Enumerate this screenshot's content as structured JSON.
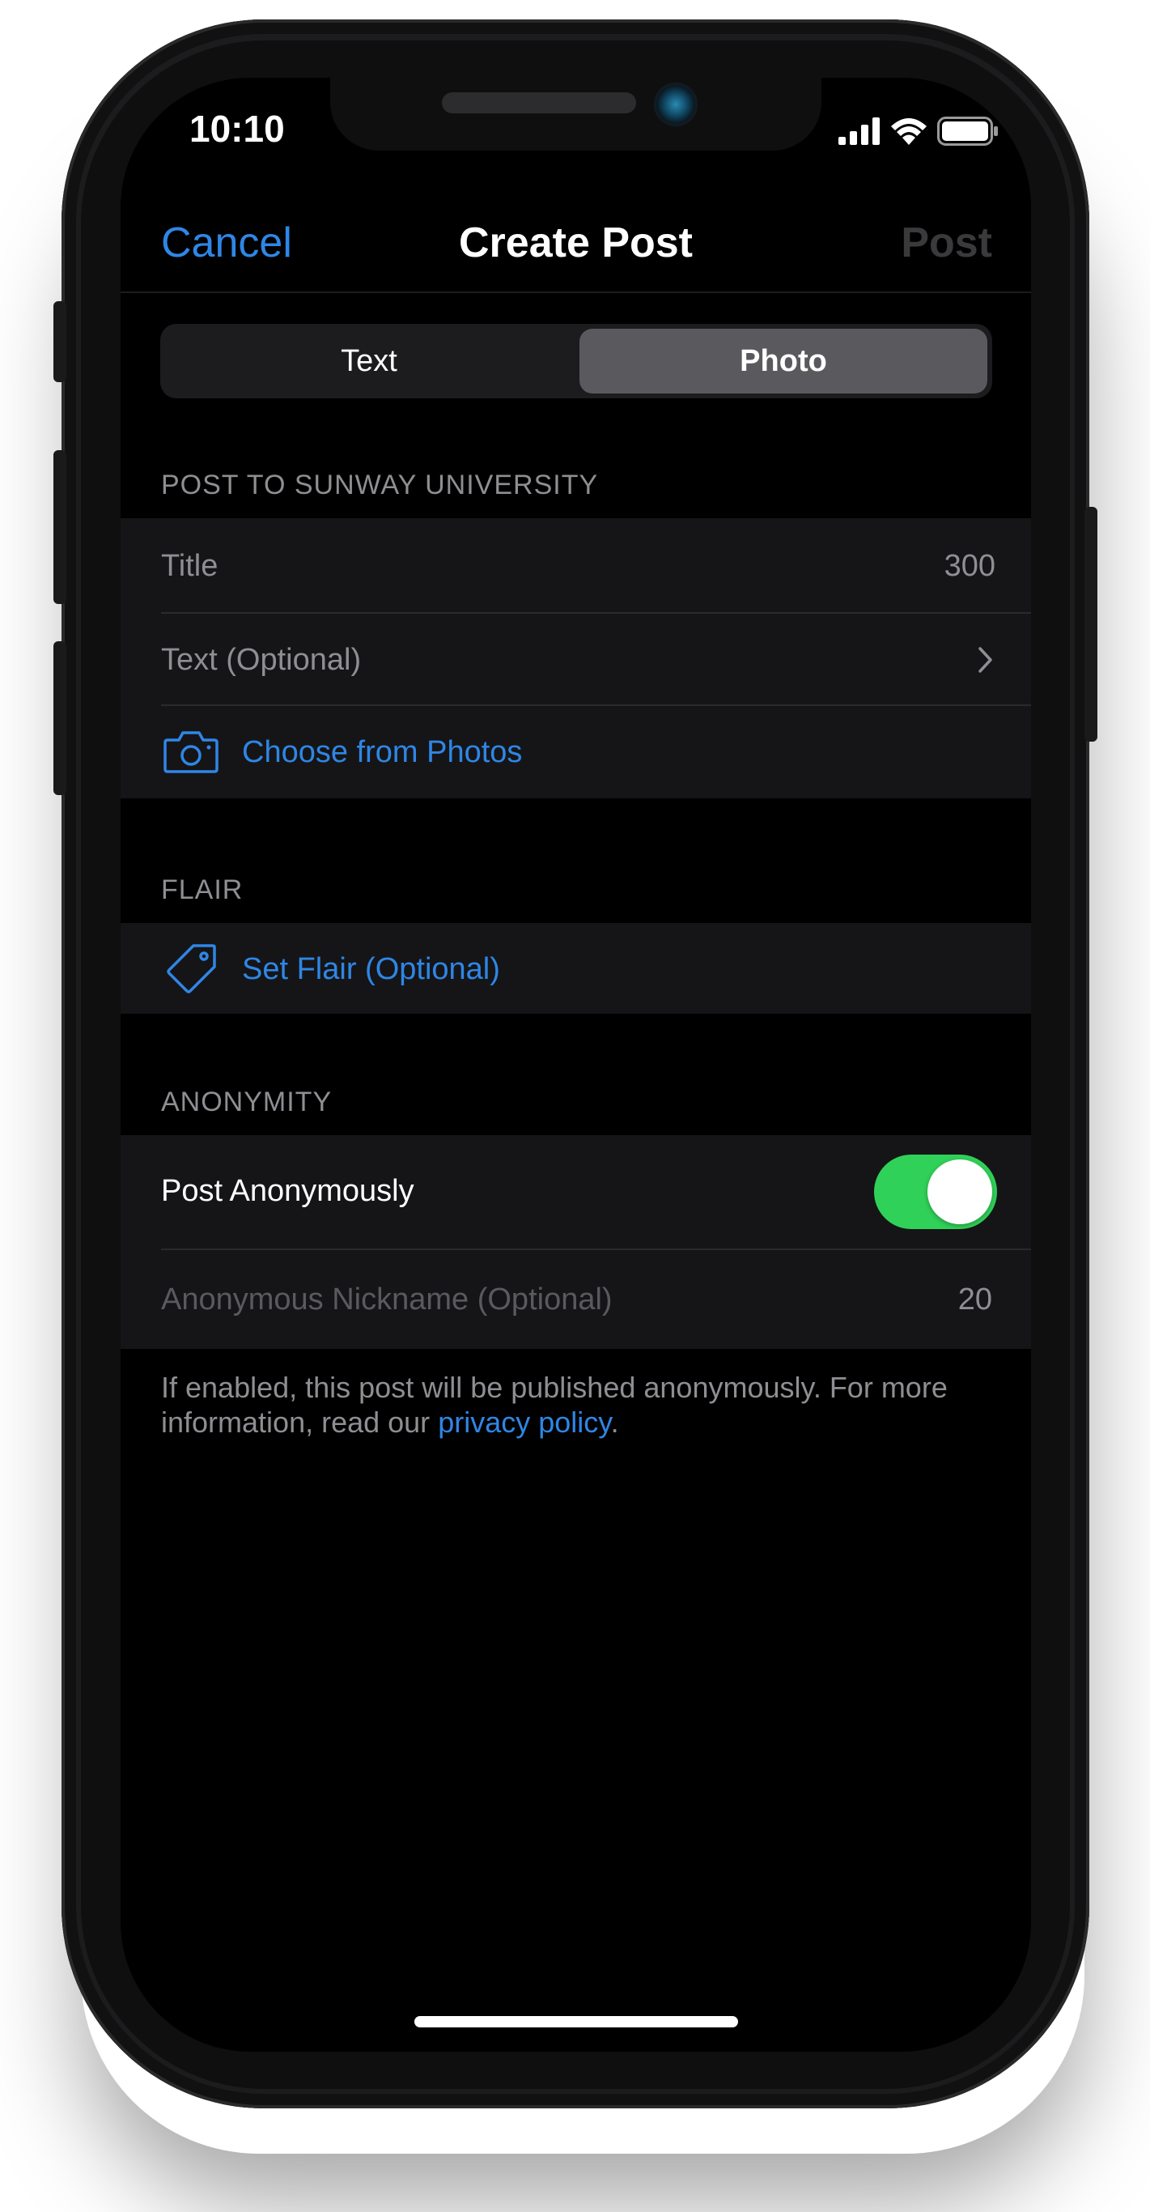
{
  "status_bar": {
    "time": "10:10"
  },
  "nav": {
    "cancel": "Cancel",
    "title": "Create Post",
    "post": "Post"
  },
  "segments": {
    "text": "Text",
    "photo": "Photo",
    "selected": "Photo"
  },
  "post_section": {
    "header": "POST TO SUNWAY UNIVERSITY",
    "title_placeholder": "Title",
    "title_count": "300",
    "text_placeholder": "Text (Optional)",
    "choose_photos": "Choose from Photos"
  },
  "flair_section": {
    "header": "FLAIR",
    "set_flair": "Set Flair (Optional)"
  },
  "anonymity_section": {
    "header": "ANONYMITY",
    "post_anonymously": "Post Anonymously",
    "toggle_on": true,
    "nickname_placeholder": "Anonymous Nickname (Optional)",
    "nickname_count": "20",
    "footnote_prefix": "If enabled, this post will be published anonymously. For more information, read our ",
    "footnote_link": "privacy policy",
    "footnote_suffix": "."
  },
  "colors": {
    "accent": "#2f86e6",
    "toggle": "#30d158",
    "background": "#000000",
    "cell": "#151517"
  }
}
